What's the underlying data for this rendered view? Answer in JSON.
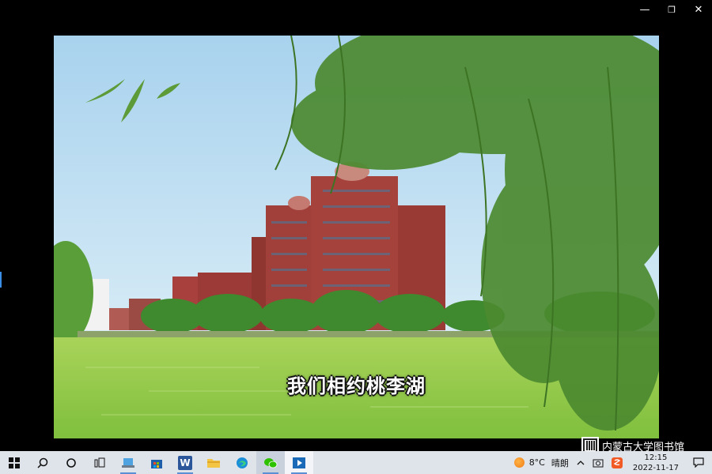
{
  "window": {
    "minimize_glyph": "—",
    "maximize_glyph": "❐",
    "close_glyph": "✕"
  },
  "video": {
    "subtitle": "我们相约桃李湖"
  },
  "watermark": {
    "text": "内蒙古大学图书馆"
  },
  "taskbar": {
    "apps": [
      {
        "icon": "windows-start-icon"
      },
      {
        "icon": "search-icon"
      },
      {
        "icon": "cortana-icon"
      },
      {
        "icon": "task-view-icon"
      },
      {
        "icon": "laptop-icon"
      },
      {
        "icon": "store-icon"
      },
      {
        "icon": "word-icon",
        "label": "W"
      },
      {
        "icon": "file-explorer-icon"
      },
      {
        "icon": "edge-icon"
      },
      {
        "icon": "wechat-icon"
      },
      {
        "icon": "media-player-icon"
      }
    ],
    "weather": {
      "temperature": "8°C",
      "condition": "晴朗"
    },
    "clock": {
      "time": "12:15",
      "date": "2022-11-17"
    },
    "colors": {
      "taskbar_bg": "#dfe4ea",
      "accent": "#5b8fd3"
    }
  }
}
